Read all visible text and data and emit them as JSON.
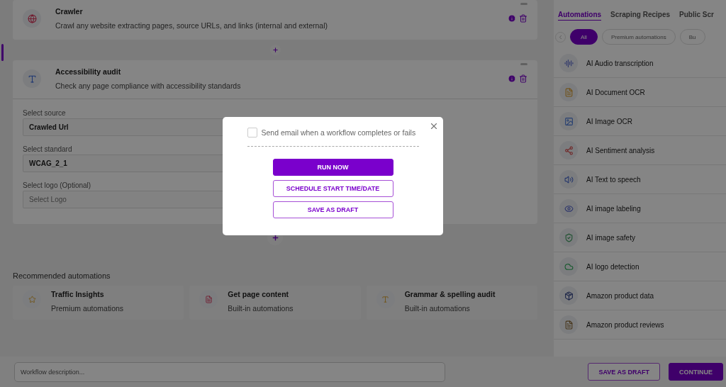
{
  "workflow_steps": [
    {
      "title": "Crawler",
      "description": "Crawl any website extracting pages, source URLs, and links (internal and external)"
    },
    {
      "title": "Accessibility audit",
      "description": "Check any page compliance with accessibility standards",
      "fields": [
        {
          "label": "Select source",
          "value": "Crawled Url"
        },
        {
          "label": "Select standard",
          "value": "WCAG_2_1"
        },
        {
          "label": "Select logo (Optional)",
          "placeholder": "Select Logo"
        }
      ]
    }
  ],
  "recommended": {
    "heading": "Recommended automations",
    "items": [
      {
        "title": "Traffic Insights",
        "subtitle": "Premium automations"
      },
      {
        "title": "Get page content",
        "subtitle": "Built-in automations"
      },
      {
        "title": "Grammar & spelling audit",
        "subtitle": "Built-in automations"
      }
    ]
  },
  "description_field": {
    "placeholder": "Workflow description..."
  },
  "footer_buttons": [
    {
      "label": "SAVE AS DRAFT",
      "kind": "outline"
    },
    {
      "label": "CONTINUE",
      "kind": "primary"
    }
  ],
  "sidebar": {
    "tabs": [
      {
        "label": "Automations",
        "selected": true
      },
      {
        "label": "Scraping Recipes",
        "selected": false
      },
      {
        "label": "Public Scr",
        "selected": false
      }
    ],
    "filters": [
      {
        "label": "All",
        "selected": true
      },
      {
        "label": "Premium automations",
        "selected": false
      },
      {
        "label": "Bu",
        "selected": false
      }
    ],
    "automations": [
      "AI Audio transcription",
      "AI Document OCR",
      "AI Image OCR",
      "AI Sentiment analysis",
      "AI Text to speech",
      "AI image labeling",
      "AI image safety",
      "AI logo detection",
      "Amazon product data",
      "Amazon product reviews"
    ]
  },
  "modal": {
    "checkbox": {
      "label": "Send email when a workflow completes or fails",
      "checked": false
    },
    "buttons": [
      {
        "label": "RUN NOW",
        "kind": "primary"
      },
      {
        "label": "SCHEDULE START TIME/DATE",
        "kind": "outline"
      },
      {
        "label": "SAVE AS DRAFT",
        "kind": "outline"
      }
    ]
  }
}
